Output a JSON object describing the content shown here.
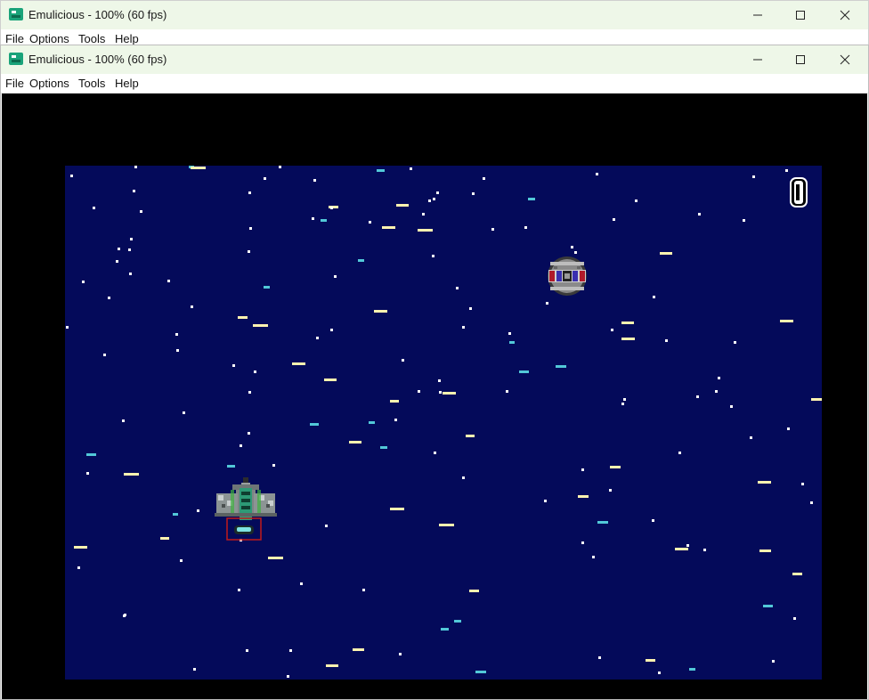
{
  "window_back": {
    "title": "Emulicious - 100% (60 fps)",
    "menu": [
      "File",
      "Options",
      "Tools",
      "Help"
    ]
  },
  "window_front": {
    "title": "Emulicious - 100% (60 fps)",
    "menu": [
      "File",
      "Options",
      "Tools",
      "Help"
    ]
  },
  "game": {
    "score": "0",
    "colors": {
      "space": "#040a5a",
      "border": "#000000",
      "star_white": "#ffffff",
      "star_yellow": "#fff3b0",
      "star_cyan": "#52c8d8"
    },
    "sprites": [
      "player-ship",
      "enemy-orb"
    ]
  }
}
